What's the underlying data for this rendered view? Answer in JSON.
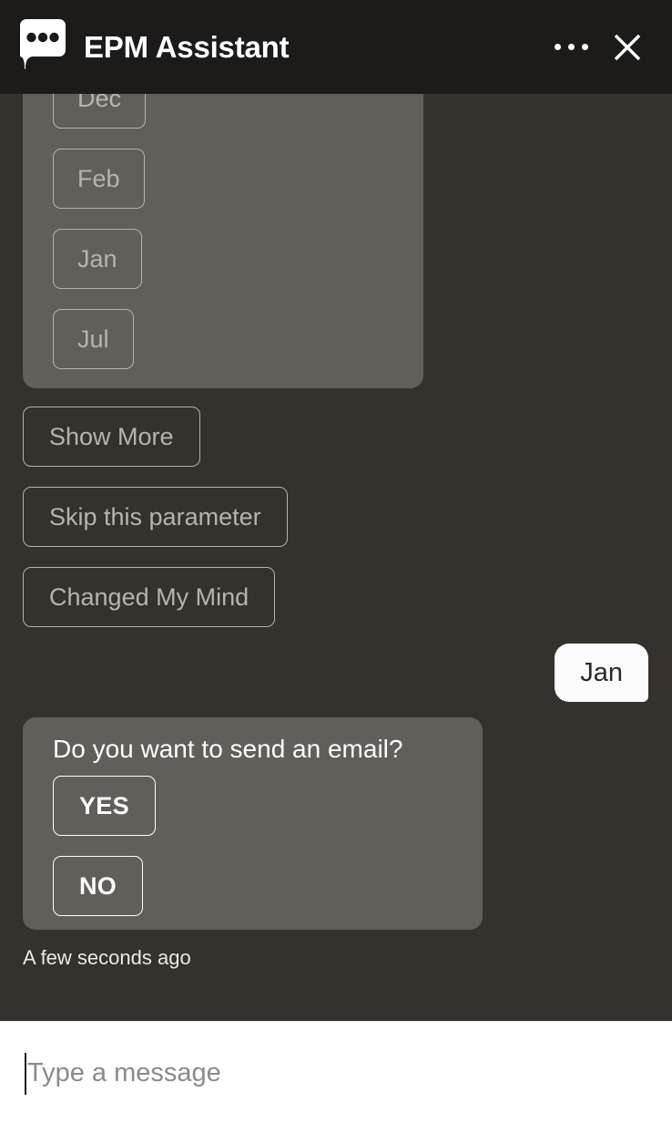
{
  "header": {
    "title": "EPM Assistant",
    "brand_icon": "chat-bubble-dots-icon",
    "menu_icon": "overflow-menu-icon",
    "close_icon": "close-icon",
    "background_color": "#1c1b1a",
    "title_color": "#ffffff"
  },
  "theme": {
    "page_background": "#35322d",
    "bot_bubble_background": "#625e59",
    "user_bubble_background": "#fbfbfb",
    "dim_text": "#b8b3ad",
    "bright_text": "#ffffff",
    "composer_background": "#ffffff"
  },
  "chat": {
    "month_options_bubble": {
      "name": "month-options",
      "options": [
        {
          "label": "Dec"
        },
        {
          "label": "Feb"
        },
        {
          "label": "Jan"
        },
        {
          "label": "Jul"
        }
      ]
    },
    "actions": [
      {
        "label": "Show More"
      },
      {
        "label": "Skip this parameter"
      },
      {
        "label": "Changed My Mind"
      }
    ],
    "user_message": {
      "text": "Jan"
    },
    "confirm_bubble": {
      "prompt": "Do you want to send an email?",
      "options": [
        {
          "label": "YES"
        },
        {
          "label": "NO"
        }
      ]
    },
    "timestamp": "A few seconds ago"
  },
  "composer": {
    "placeholder": "Type a message",
    "value": ""
  }
}
